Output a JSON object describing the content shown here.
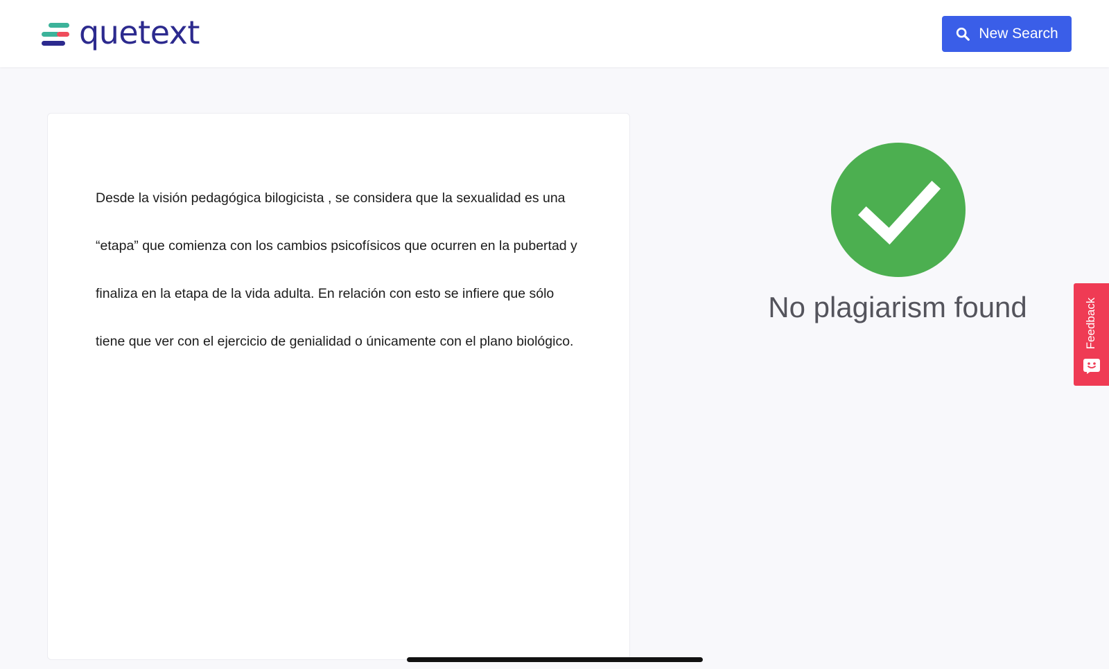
{
  "header": {
    "logo_text": "quetext",
    "new_search_label": "New Search"
  },
  "document": {
    "text": "Desde la visión pedagógica bilogicista , se considera que la sexualidad es una “etapa” que comienza con los cambios psicofísicos que ocurren en la pubertad y finaliza en la etapa de la vida adulta. En relación con esto se infiere que sólo tiene que ver con el ejercicio de genialidad o únicamente con el plano biológico."
  },
  "result": {
    "status_text": "No plagiarism found",
    "icon": "checkmark-circle-icon"
  },
  "feedback": {
    "label": "Feedback",
    "icon": "chat-face-icon"
  },
  "colors": {
    "brand_text": "#2c2a8e",
    "primary_button": "#3a5ee8",
    "success_green": "#4caf50",
    "feedback_red": "#ef3b54",
    "logo_teal": "#3cb39a",
    "logo_red": "#ef4d5c",
    "logo_navy": "#2c2a8e"
  }
}
